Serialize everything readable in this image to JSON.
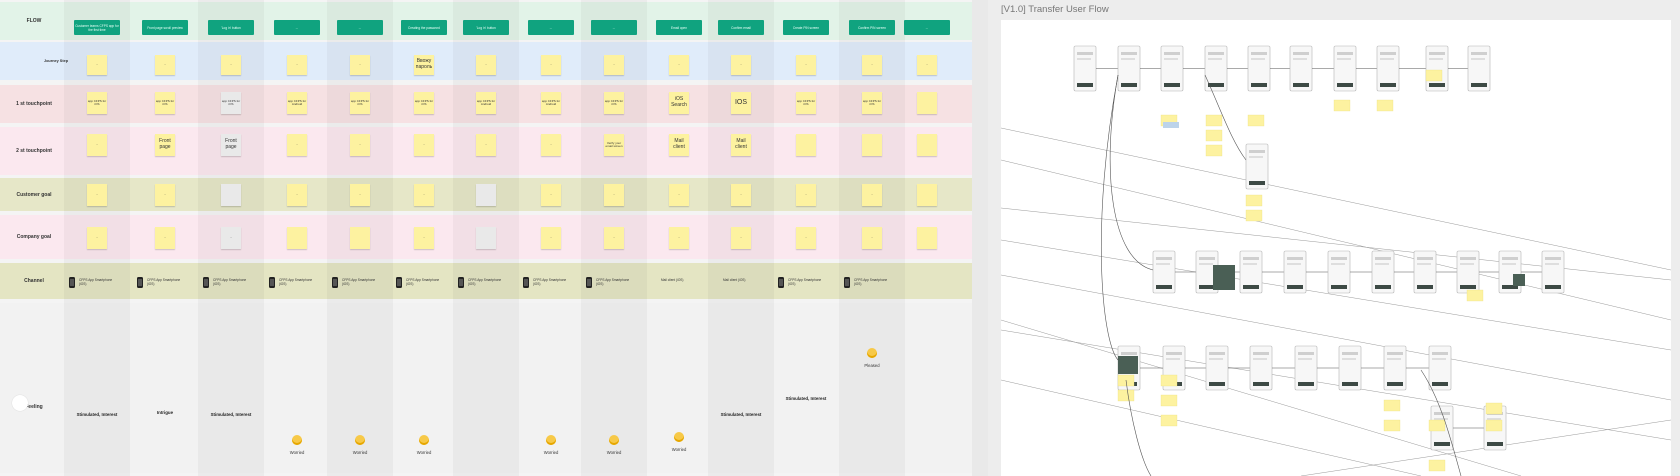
{
  "journey_map": {
    "rows": [
      {
        "key": "flow",
        "label": "FLOW"
      },
      {
        "key": "journey",
        "label": "Journey Step"
      },
      {
        "key": "tp1",
        "label": "1 st touchpoint"
      },
      {
        "key": "tp2",
        "label": "2 st touchpoint"
      },
      {
        "key": "customer_goal",
        "label": "Customer goal"
      },
      {
        "key": "company_goal",
        "label": "Company goal"
      },
      {
        "key": "channel",
        "label": "Channel"
      },
      {
        "key": "feeling",
        "label": "Feeling"
      }
    ],
    "columns": [
      {
        "flow": "Customer learns CFPS app for the first time",
        "journey": "...",
        "tp1": "app CFPS for iOS",
        "tp2": "...",
        "customer_goal": "...",
        "company_goal": "...",
        "channel": "CFPS App Smartphone (iOS)",
        "feeling": "Stimulated, Interest",
        "emoji": ""
      },
      {
        "flow": "Front page scroll preview",
        "journey": "...",
        "tp1": "app CFPS for iOS",
        "tp2": "Front page",
        "customer_goal": "...",
        "company_goal": "...",
        "channel": "CFPS App Smartphone (iOS)",
        "feeling": "Intrigue",
        "emoji": ""
      },
      {
        "flow": "'Log in' button",
        "journey": "...",
        "tp1": "app CFPS for iOS",
        "tp2": "Front page",
        "customer_goal": "",
        "company_goal": "...",
        "channel": "CFPS App Smartphone (iOS)",
        "feeling": "Stimulated, Interest",
        "emoji": ""
      },
      {
        "flow": "...",
        "journey": "...",
        "tp1": "app CFPS for Android",
        "tp2": "...",
        "customer_goal": "...",
        "company_goal": "",
        "channel": "CFPS App Smartphone (iOS)",
        "feeling": "",
        "emoji": "Worried"
      },
      {
        "flow": "...",
        "journey": "...",
        "tp1": "app CFPS for iOS",
        "tp2": "...",
        "customer_goal": "...",
        "company_goal": "",
        "channel": "CFPS App Smartphone (iOS)",
        "feeling": "",
        "emoji": "Worried"
      },
      {
        "flow": "Creating the password",
        "journey": "Ввожу пароль",
        "tp1": "app CFPS for iOS",
        "tp2": "...",
        "customer_goal": "...",
        "company_goal": "...",
        "channel": "CFPS App Smartphone (iOS)",
        "feeling": "",
        "emoji": "Worried"
      },
      {
        "flow": "'Log in' button",
        "journey": "...",
        "tp1": "app CFPS for Android",
        "tp2": "...",
        "customer_goal": "",
        "company_goal": "",
        "channel": "CFPS App Smartphone (iOS)",
        "feeling": "",
        "emoji": ""
      },
      {
        "flow": "...",
        "journey": "...",
        "tp1": "app CFPS for Android",
        "tp2": "...",
        "customer_goal": "...",
        "company_goal": "...",
        "channel": "CFPS App Smartphone (iOS)",
        "feeling": "",
        "emoji": "Worried"
      },
      {
        "flow": "...",
        "journey": "...",
        "tp1": "app CFPS for iOS",
        "tp2": "Verify your email screen",
        "customer_goal": "...",
        "company_goal": "...",
        "channel": "CFPS App Smartphone (iOS)",
        "feeling": "",
        "emoji": "Worried"
      },
      {
        "flow": "Email open",
        "journey": "...",
        "tp1": "iOS Search",
        "tp2": "Mail client",
        "customer_goal": "...",
        "company_goal": "...",
        "channel": "Mail client (iOS)",
        "feeling": "",
        "emoji": "Worried"
      },
      {
        "flow": "Confirm email",
        "journey": "...",
        "tp1": "IOS",
        "tp2": "Mail client",
        "customer_goal": "...",
        "company_goal": "...",
        "channel": "Mail client (iOS)",
        "feeling": "Stimulated, Interest",
        "emoji": ""
      },
      {
        "flow": "Create PIN screen",
        "journey": "...",
        "tp1": "app CFPS for iOS",
        "tp2": "",
        "customer_goal": "...",
        "company_goal": "...",
        "channel": "CFPS App Smartphone (iOS)",
        "feeling": "Stimulated, Interest",
        "emoji": ""
      },
      {
        "flow": "Confirm PIN screen",
        "journey": "...",
        "tp1": "app CFPS for iOS",
        "tp2": "",
        "customer_goal": "...",
        "company_goal": "...",
        "channel": "CFPS App Smartphone (iOS)",
        "feeling": "",
        "emoji": "Pleased"
      },
      {
        "flow": "...",
        "journey": "...",
        "tp1": "",
        "tp2": "",
        "customer_goal": "",
        "company_goal": "",
        "channel": "",
        "feeling": "",
        "emoji": ""
      }
    ]
  },
  "flow_board": {
    "title": "[V1.0] Transfer User Flow"
  },
  "colors": {
    "header_green": "#10a37f",
    "sticky_yellow": "#fdf2a0",
    "emoji_yellow": "#f7c948"
  }
}
